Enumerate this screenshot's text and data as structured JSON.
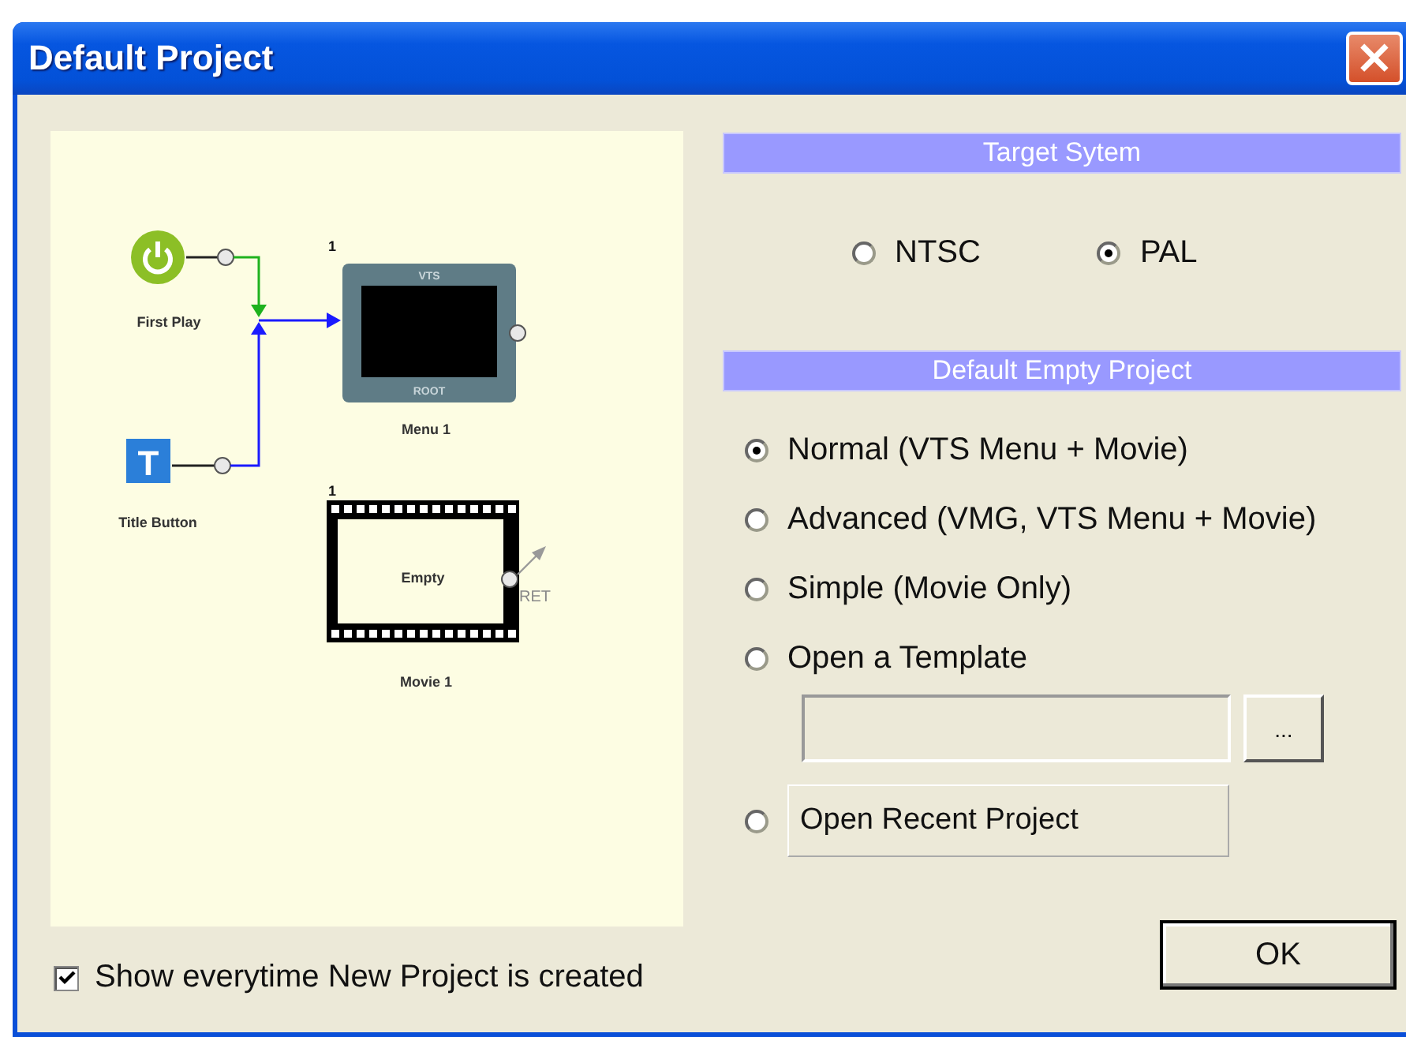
{
  "window": {
    "title": "Default Project",
    "close": "×"
  },
  "diagram": {
    "nodes": [
      {
        "kind": "first_play",
        "label": "First Play"
      },
      {
        "kind": "title_button",
        "label": "Title Button",
        "glyph": "T"
      },
      {
        "kind": "menu",
        "label": "Menu 1",
        "number": "1",
        "top": "VTS",
        "bottom": "ROOT"
      },
      {
        "kind": "movie",
        "label": "Movie 1",
        "number": "1",
        "content": "Empty",
        "port": "RET"
      }
    ]
  },
  "target_system": {
    "header": "Target Sytem",
    "options": [
      {
        "label": "NTSC",
        "selected": false
      },
      {
        "label": "PAL",
        "selected": true
      }
    ]
  },
  "default_project": {
    "header": "Default Empty Project",
    "options": [
      {
        "kind": "radio",
        "label": "Normal (VTS Menu + Movie)",
        "selected": true
      },
      {
        "kind": "radio",
        "label": "Advanced (VMG, VTS Menu + Movie)",
        "selected": false
      },
      {
        "kind": "radio",
        "label": "Simple (Movie Only)",
        "selected": false
      },
      {
        "kind": "template",
        "label": "Open a Template",
        "selected": false,
        "browse": "..."
      },
      {
        "kind": "recent",
        "label": "Open Recent Project",
        "selected": false
      }
    ]
  },
  "show_every_time": {
    "label": "Show everytime New Project is created",
    "checked": true
  },
  "ok_button": "OK"
}
